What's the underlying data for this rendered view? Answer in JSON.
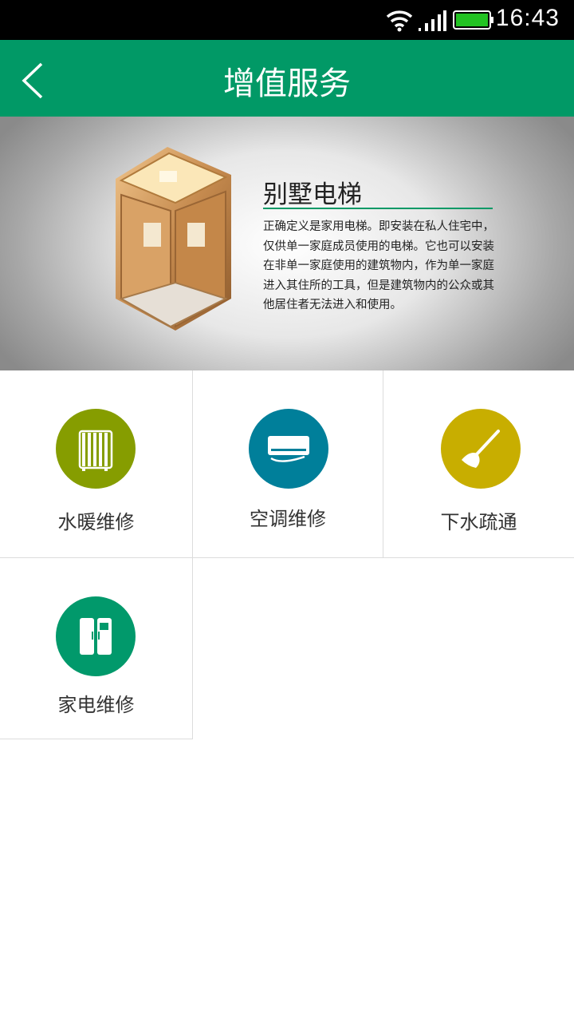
{
  "status_bar": {
    "time": "16:43",
    "battery_color": "#22c322"
  },
  "header": {
    "title": "增值服务",
    "back_icon": "chevron-left-icon",
    "color": "#019966"
  },
  "banner": {
    "title": "别墅电梯",
    "description": "正确定义是家用电梯。即安装在私人住宅中，仅供单一家庭成员使用的电梯。它也可以安装在非单一家庭使用的建筑物内，作为单一家庭进入其住所的工具，但是建筑物内的公众或其他居住者无法进入和使用。",
    "image": "villa-elevator-image"
  },
  "services": [
    {
      "label": "水暖维修",
      "icon": "radiator-icon",
      "color": "#869d00"
    },
    {
      "label": "空调维修",
      "icon": "air-conditioner-icon",
      "color": "#007f9a"
    },
    {
      "label": "下水疏通",
      "icon": "plunger-icon",
      "color": "#c8ae00"
    },
    {
      "label": "家电维修",
      "icon": "refrigerator-icon",
      "color": "#01996b"
    }
  ]
}
